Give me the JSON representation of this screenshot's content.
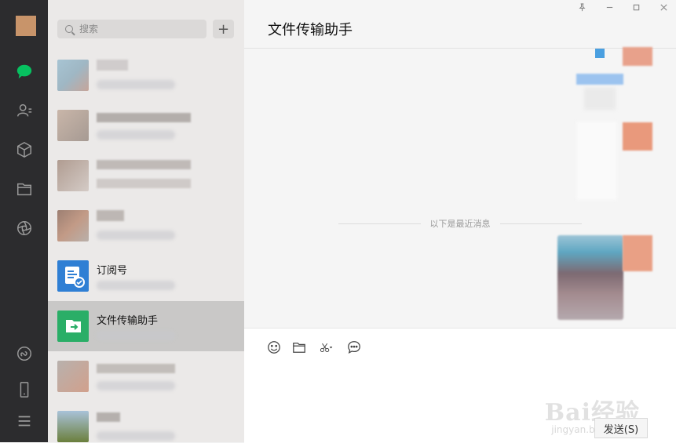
{
  "search": {
    "placeholder": "搜索"
  },
  "add_button": "+",
  "chats": [
    {
      "name": "",
      "blurred": true
    },
    {
      "name": "",
      "blurred": true
    },
    {
      "name": "",
      "blurred": true
    },
    {
      "name": "",
      "blurred": true
    },
    {
      "name": "订阅号",
      "icon": "subscription-icon"
    },
    {
      "name": "文件传输助手",
      "icon": "file-transfer-icon",
      "selected": true
    },
    {
      "name": "",
      "blurred": true
    },
    {
      "name": "",
      "blurred": true
    }
  ],
  "conversation": {
    "title": "文件传输助手",
    "divider_text": "以下是最近消息"
  },
  "window_controls": [
    "pin-icon",
    "minimize-icon",
    "maximize-icon",
    "close-icon"
  ],
  "composer": {
    "send_label": "发送(S)"
  },
  "watermark": {
    "main": "Bai经验",
    "sub": "jingyan.baidu.com"
  },
  "colors": {
    "sidebar": "#2c2c2e",
    "chat_green": "#07c160",
    "list_bg": "#ebe9e8",
    "selected": "#c9c8c7"
  }
}
